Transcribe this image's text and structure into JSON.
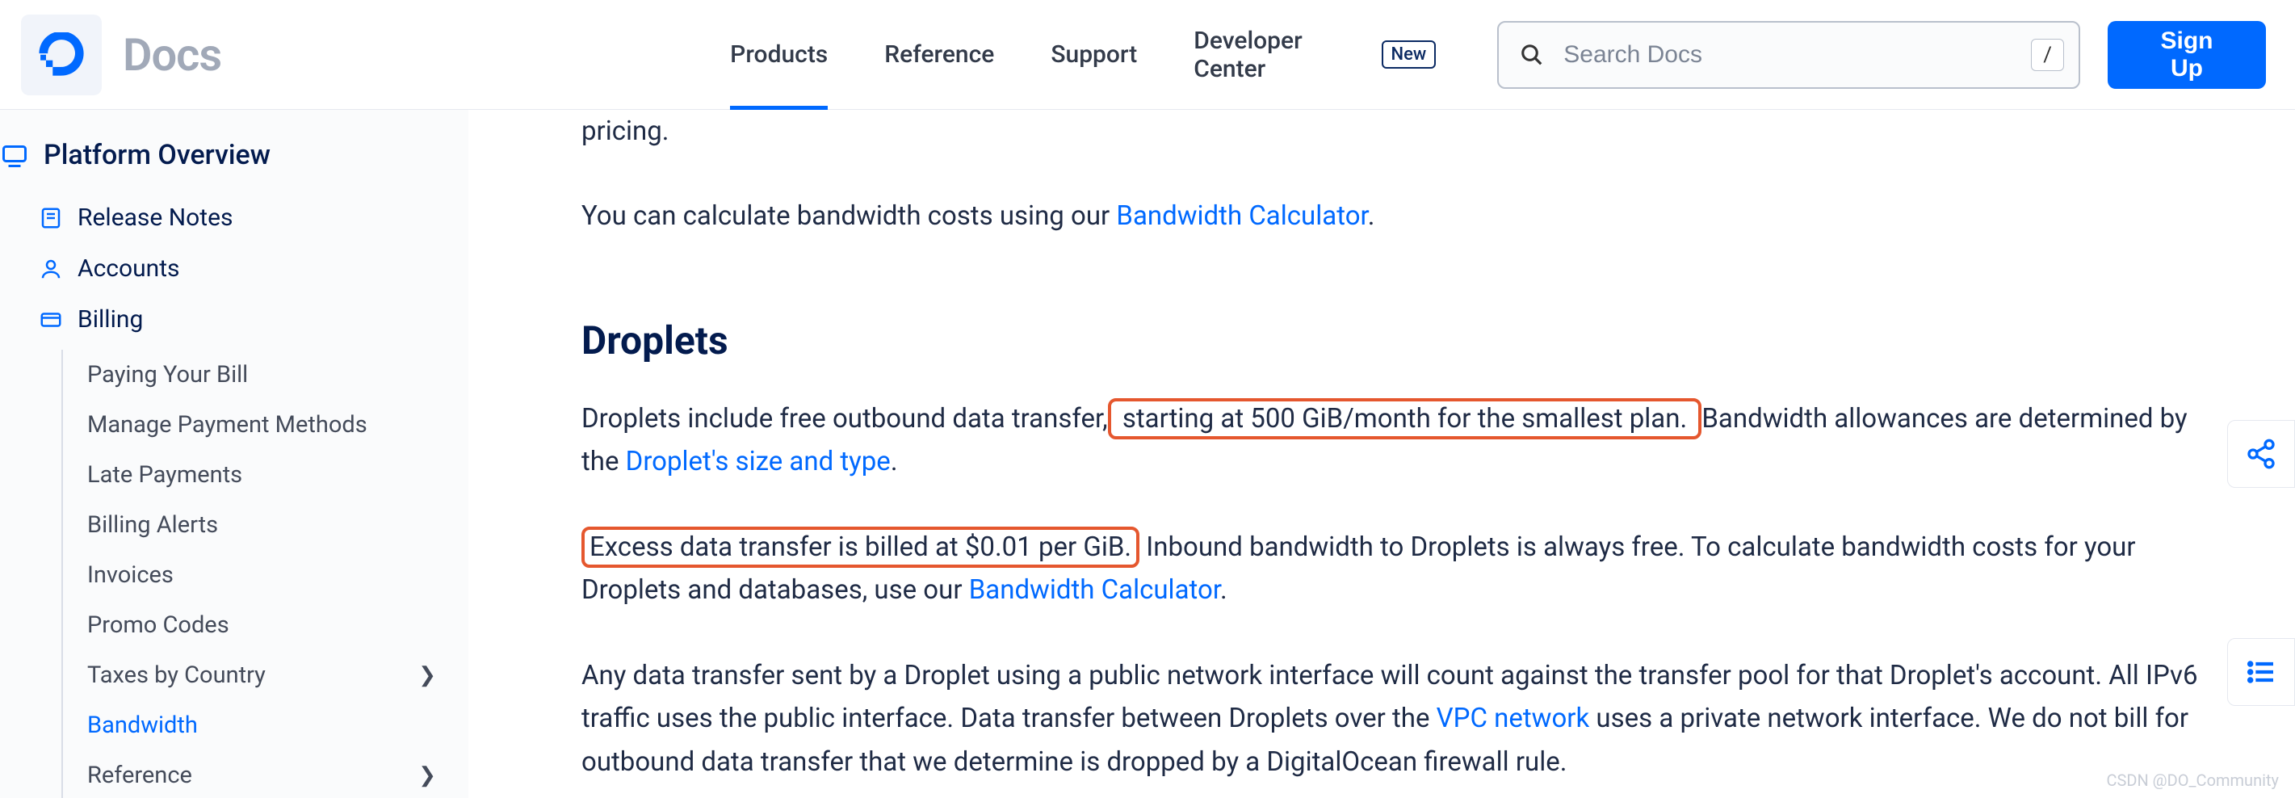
{
  "header": {
    "docs_title": "Docs",
    "nav": {
      "products": "Products",
      "reference": "Reference",
      "support": "Support",
      "developer_center": "Developer Center",
      "new_badge": "New"
    },
    "search": {
      "placeholder": "Search Docs",
      "kbd": "/"
    },
    "signup": "Sign Up"
  },
  "sidebar": {
    "top": "Platform Overview",
    "items": {
      "release_notes": "Release Notes",
      "accounts": "Accounts",
      "billing": "Billing"
    },
    "billing_children": {
      "paying": "Paying Your Bill",
      "manage_payment": "Manage Payment Methods",
      "late_payments": "Late Payments",
      "billing_alerts": "Billing Alerts",
      "invoices": "Invoices",
      "promo_codes": "Promo Codes",
      "taxes": "Taxes by Country",
      "bandwidth": "Bandwidth",
      "reference": "Reference"
    }
  },
  "content": {
    "pricing_tail": "pricing.",
    "calc_intro": "You can calculate bandwidth costs using our ",
    "calc_link": "Bandwidth Calculator",
    "period": ".",
    "h2_droplets": "Droplets",
    "droplets_p1_a": "Droplets include free outbound data transfer,",
    "droplets_p1_hl": " starting at 500 GiB/month for the smallest plan. ",
    "droplets_p1_b": "Bandwidth allowances are determined by the ",
    "droplets_p1_link": "Droplet's size and type",
    "droplets_p2_hl": "Excess data transfer is billed at $0.01 per GiB.",
    "droplets_p2_a": " Inbound bandwidth to Droplets is always free. To calculate bandwidth costs for your Droplets and databases, use our ",
    "droplets_p2_link": "Bandwidth Calculator",
    "droplets_p3_a": "Any data transfer sent by a Droplet using a public network interface will count against the transfer pool for that Droplet's account. All IPv6 traffic uses the public interface. Data transfer between Droplets over the ",
    "droplets_p3_link": "VPC network",
    "droplets_p3_b": " uses a private network interface. We do not bill for outbound data transfer that we determine is dropped by a DigitalOcean firewall rule."
  },
  "watermark": "CSDN @DO_Community"
}
